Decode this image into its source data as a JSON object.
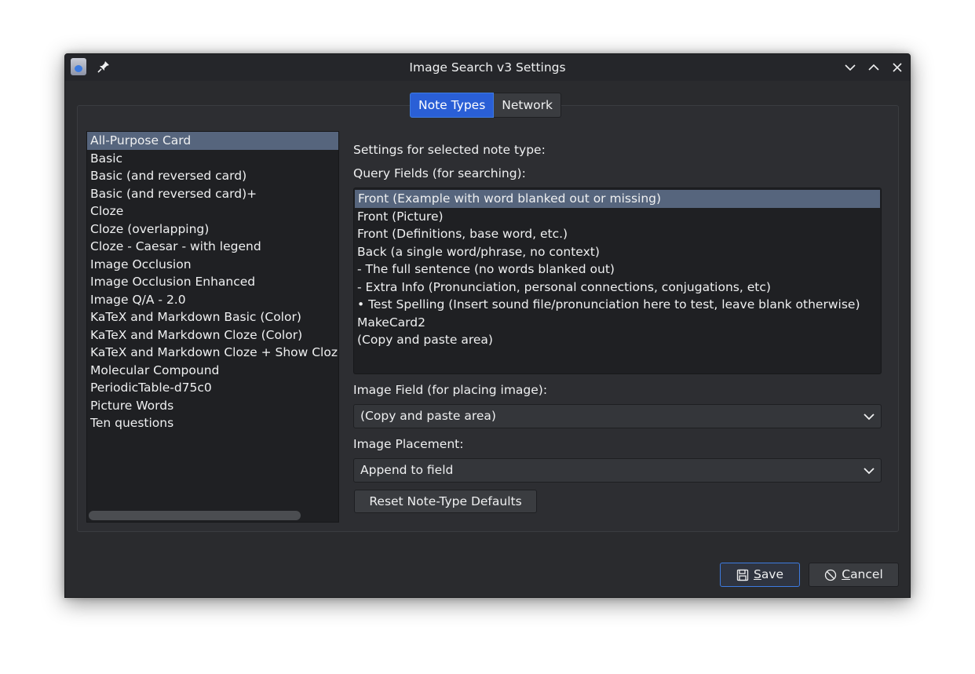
{
  "window": {
    "title": "Image Search v3 Settings"
  },
  "tabs": [
    {
      "label": "Note Types",
      "active": true
    },
    {
      "label": "Network",
      "active": false
    }
  ],
  "note_types": [
    "All-Purpose Card",
    "Basic",
    "Basic (and reversed card)",
    "Basic (and reversed card)+",
    "Cloze",
    "Cloze (overlapping)",
    "Cloze - Caesar - with legend",
    "Image Occlusion",
    "Image Occlusion Enhanced",
    "Image Q/A - 2.0",
    "KaTeX and Markdown Basic (Color)",
    "KaTeX and Markdown Cloze (Color)",
    "KaTeX and Markdown Cloze + Show Cloze",
    "Molecular Compound",
    "PeriodicTable-d75c0",
    "Picture Words",
    "Ten questions"
  ],
  "selected_note_type": "All-Purpose Card",
  "settings": {
    "heading": "Settings for selected note type:",
    "query_fields_label": "Query Fields (for searching):",
    "query_fields": [
      "Front (Example with word blanked out or missing)",
      "Front (Picture)",
      "Front (Definitions, base word, etc.)",
      "Back (a single word/phrase, no context)",
      "- The full sentence (no words blanked out)",
      "- Extra Info (Pronunciation, personal connections, conjugations, etc)",
      "• Test Spelling (Insert sound file/pronunciation here to test, leave blank otherwise)",
      "MakeCard2",
      "(Copy and paste area)"
    ],
    "selected_query_field": "Front (Example with word blanked out or missing)",
    "image_field_label": "Image Field (for placing image):",
    "image_field_value": "(Copy and paste area)",
    "image_placement_label": "Image Placement:",
    "image_placement_value": "Append to field",
    "reset_label": "Reset Note-Type Defaults"
  },
  "buttons": {
    "save_mnemonic": "S",
    "save_rest": "ave",
    "cancel_mnemonic": "C",
    "cancel_rest": "ancel"
  },
  "colors": {
    "accent": "#3d7be0",
    "selection": "#56657d",
    "window_bg": "#2a2b2e"
  }
}
